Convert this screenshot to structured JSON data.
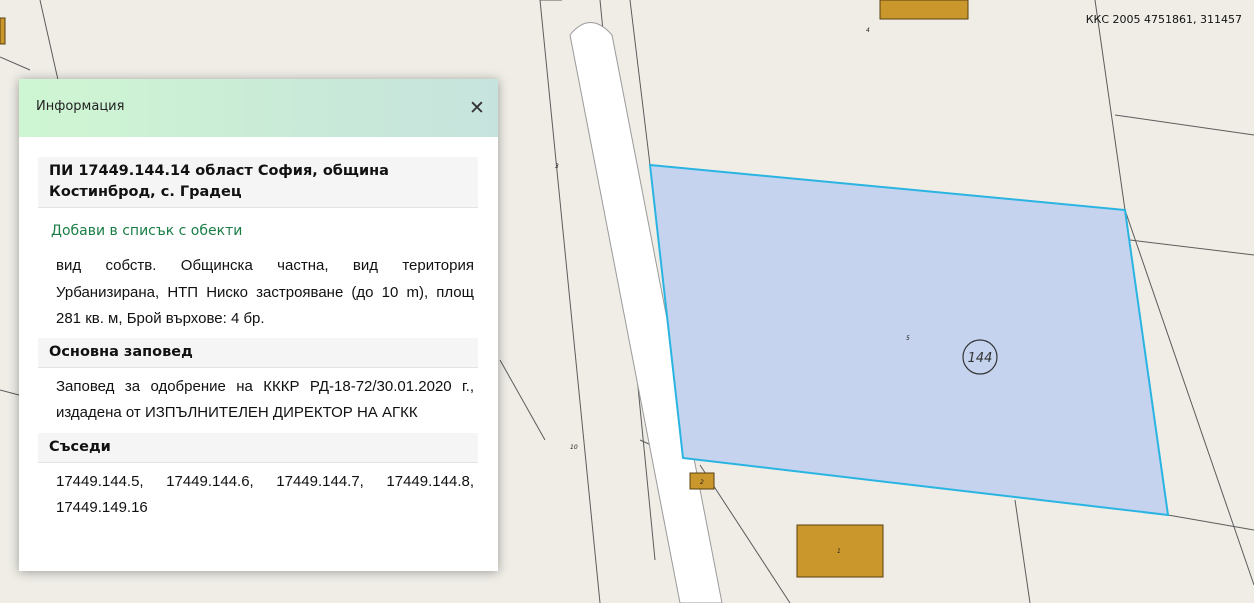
{
  "map": {
    "coordinates": "ККС 2005 4751861, 311457",
    "parcel_number_label": "144",
    "plot_labels": [
      "4",
      "3",
      "5",
      "10",
      "2",
      "1"
    ],
    "colors": {
      "background": "#efede6",
      "parcel_fill": "#c5d3ef",
      "parcel_outline": "#2ab4e2",
      "building": "#c9972c",
      "road": "#ffffff"
    }
  },
  "panel": {
    "title": "Информация",
    "close_icon": "close-icon",
    "parcel_title": "ПИ 17449.144.14 област София, община Костинброд, с. Градец",
    "add_link": "Добави в списък с обекти",
    "details": "вид собств. Общинска частна, вид територия Урбанизирана, НТП Ниско застрояване (до 10 m), площ 281 кв. м, Брой върхове: 4 бр.",
    "order_heading": "Основна заповед",
    "order_text": "Заповед за одобрение на КККР РД-18-72/30.01.2020 г., издадена от ИЗПЪЛНИТЕЛЕН ДИРЕКТОР НА АГКК",
    "neighbors_heading": "Съседи",
    "neighbors_text": "17449.144.5, 17449.144.6, 17449.144.7, 17449.144.8, 17449.149.16"
  }
}
